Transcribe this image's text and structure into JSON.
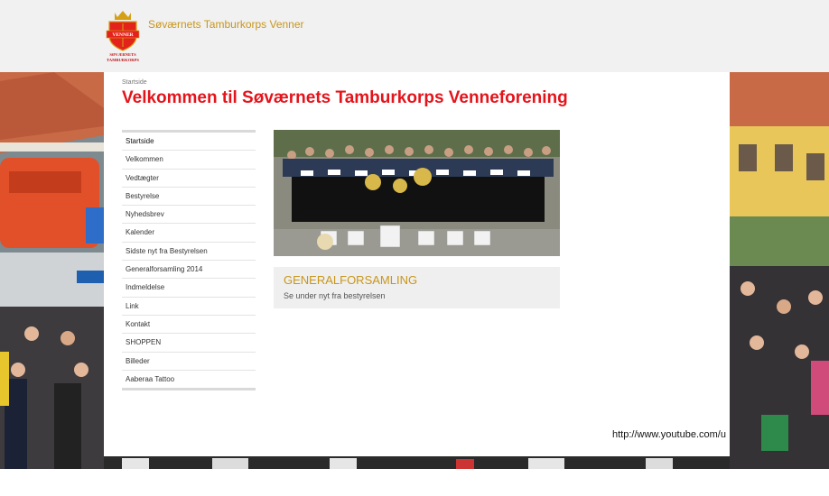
{
  "header": {
    "site_name": "Søværnets Tamburkorps Venner",
    "logo": {
      "icon": "crown-shield-icon",
      "badge_text": "VENNER",
      "caption_line1": "SØVÆRNETS",
      "caption_line2": "TAMBURKORPS"
    }
  },
  "main": {
    "breadcrumb": "Startside",
    "title": "Velkommen til Søværnets Tamburkorps Venneforening",
    "notice": {
      "title": "GENERALFORSAMLING",
      "text": "Se under nyt fra bestyrelsen"
    }
  },
  "sidebar": {
    "items": [
      {
        "label": "Startside"
      },
      {
        "label": "Velkommen"
      },
      {
        "label": "Vedtægter"
      },
      {
        "label": "Bestyrelse"
      },
      {
        "label": "Nyhedsbrev"
      },
      {
        "label": "Kalender"
      },
      {
        "label": "Sidste nyt fra Bestyrelsen"
      },
      {
        "label": "Generalforsamling 2014"
      },
      {
        "label": "Indmeldelse"
      },
      {
        "label": "Link"
      },
      {
        "label": "Kontakt"
      },
      {
        "label": "SHOPPEN"
      },
      {
        "label": "Billeder"
      },
      {
        "label": "Aaberaa Tattoo"
      }
    ]
  },
  "footer": {
    "link_text": "http://www.youtube.com/u"
  },
  "colors": {
    "title_red": "#e4141b",
    "gold": "#c8961a",
    "header_bg": "#f1f1f1",
    "notice_bg": "#efefef"
  }
}
